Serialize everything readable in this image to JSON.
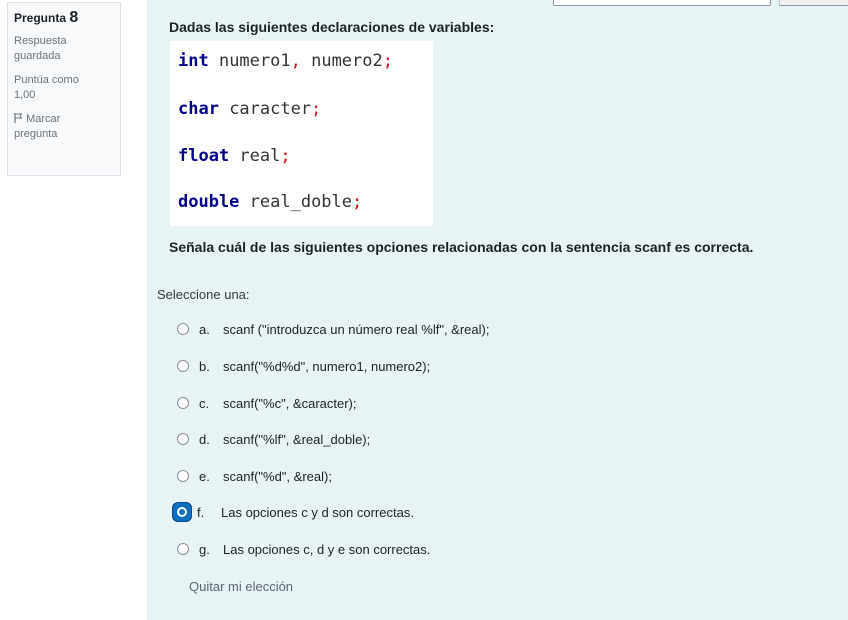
{
  "info": {
    "pregunta_label": "Pregunta",
    "pregunta_number": "8",
    "status_line1": "Respuesta",
    "status_line2": "guardada",
    "score_line1": "Puntúa como",
    "score_line2": "1,00",
    "flag_line1": "Marcar",
    "flag_line2": "pregunta"
  },
  "question": {
    "intro": "Dadas las siguientes declaraciones de variables:",
    "code": [
      {
        "kw": "int",
        "rest": " numero1",
        "semi": ",",
        "rest2": " numero2",
        "end": ";"
      },
      {
        "kw": "char",
        "rest": " caracter",
        "end": ";"
      },
      {
        "kw": "float",
        "rest": " real",
        "end": ";"
      },
      {
        "kw": "double",
        "rest": " real_doble",
        "end": ";"
      }
    ],
    "prompt_text": "Señala cuál de las siguientes opciones relacionadas con la sentencia scanf es correcta.",
    "select_label": "Seleccione una:",
    "options": [
      {
        "letter": "a.",
        "text": "scanf (\"introduzca un número real %lf\", &real);",
        "selected": false
      },
      {
        "letter": "b.",
        "text": "scanf(\"%d%d\", numero1, numero2);",
        "selected": false
      },
      {
        "letter": "c.",
        "text": "scanf(\"%c\", &caracter);",
        "selected": false
      },
      {
        "letter": "d.",
        "text": "scanf(\"%lf\", &real_doble);",
        "selected": false
      },
      {
        "letter": "e.",
        "text": "scanf(\"%d\", &real);",
        "selected": false
      },
      {
        "letter": "f.",
        "text": "Las opciones c y d son correctas.",
        "selected": true
      },
      {
        "letter": "g.",
        "text": "Las opciones c, d y e son correctas.",
        "selected": false
      }
    ],
    "clear_choice": "Quitar mi elección"
  },
  "colors": {
    "panel_bg": "#e7f3f5",
    "keyword": "#000088",
    "semicolon": "#cc1010",
    "radio_selected": "#0f6cbf"
  },
  "icons": {
    "flag": "flag-icon"
  }
}
